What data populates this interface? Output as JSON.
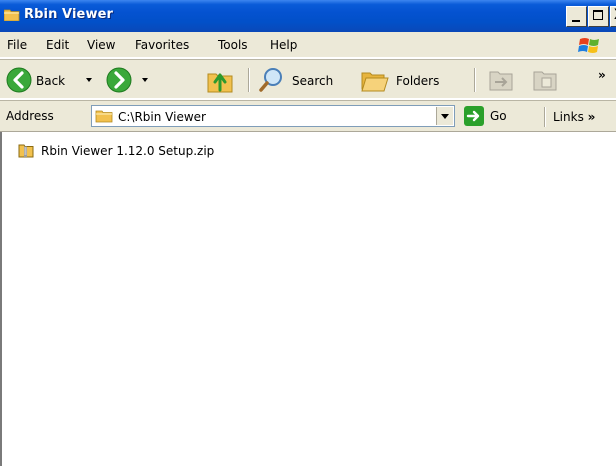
{
  "window": {
    "title": "Rbin Viewer",
    "controls": {
      "minimize": "_",
      "maximize": "□",
      "close": "X"
    }
  },
  "menu": [
    "File",
    "Edit",
    "View",
    "Favorites",
    "Tools",
    "Help"
  ],
  "toolbar": {
    "back_label": "Back",
    "search_label": "Search",
    "folders_label": "Folders",
    "more_chevron": "»"
  },
  "address": {
    "label": "Address",
    "value": "C:\\Rbin Viewer",
    "go_label": "Go",
    "links_label": "Links",
    "links_chevron": "»"
  },
  "files": [
    {
      "name": "Rbin Viewer 1.12.0 Setup.zip",
      "icon": "zip-folder-icon"
    }
  ],
  "colors": {
    "titlebar": "#0452d0",
    "chrome": "#ece9d8",
    "go_green": "#2ba02b"
  }
}
